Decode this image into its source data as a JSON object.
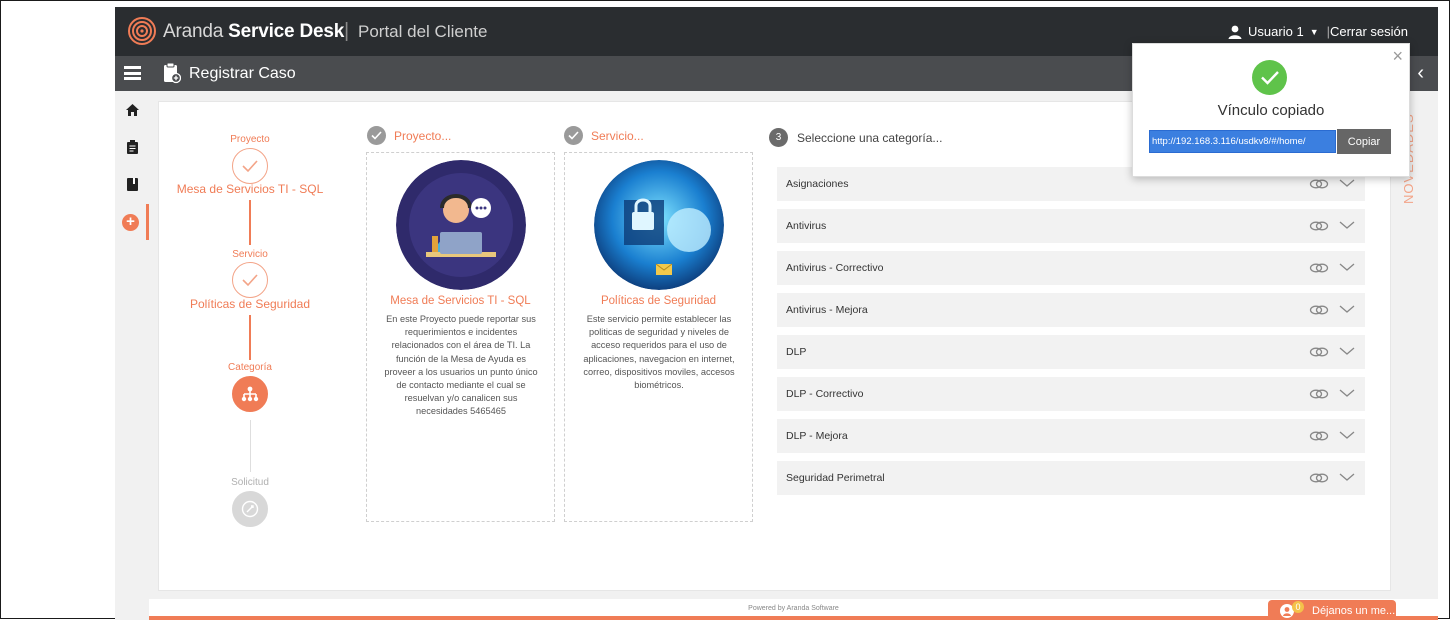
{
  "header": {
    "brand_light": "Aranda",
    "brand_bold": "Service Desk",
    "separator": "|",
    "portal": "Portal del Cliente",
    "user": "Usuario 1",
    "user_separator": "|",
    "logout": "Cerrar sesión"
  },
  "subheader": {
    "title": "Registrar Caso",
    "collapse_icon": "chevron-left"
  },
  "leftnav": {
    "items": [
      "home-icon",
      "clipboard-icon",
      "book-icon",
      "plus-icon"
    ]
  },
  "stepper": {
    "steps": [
      {
        "label": "Proyecto",
        "value": "Mesa de Servicios TI - SQL",
        "state": "done"
      },
      {
        "label": "Servicio",
        "value": "Políticas de Seguridad",
        "state": "done"
      },
      {
        "label": "Categoría",
        "value": "",
        "state": "active"
      },
      {
        "label": "Solicitud",
        "value": "",
        "state": "pending"
      }
    ]
  },
  "cards": {
    "project": {
      "header": "Proyecto...",
      "title": "Mesa de Servicios TI - SQL",
      "description": "En este Proyecto puede reportar sus requerimientos e incidentes relacionados con el área de TI. La función de la Mesa de Ayuda es proveer a los usuarios un punto único de contacto mediante el cual se resuelvan y/o canalicen sus necesidades 5465465"
    },
    "service": {
      "header": "Servicio...",
      "title": "Políticas de Seguridad",
      "description": "Este servicio permite establecer las politicas de seguridad y niveles de acceso requeridos para el uso de aplicaciones, navegacion en internet, correo, dispositivos moviles, accesos biométricos."
    }
  },
  "categories": {
    "step_number": "3",
    "header": "Seleccione una categoría...",
    "items": [
      "Asignaciones",
      "Antivirus",
      "Antivirus - Correctivo",
      "Antivirus - Mejora",
      "DLP",
      "DLP - Correctivo",
      "DLP - Mejora",
      "Seguridad Perimetral"
    ]
  },
  "side_tab": {
    "label": "NOVEDADES"
  },
  "footer": {
    "powered": "Powered by Aranda Software",
    "feedback": "Déjanos un me...",
    "feedback_badge": "0"
  },
  "popup": {
    "message": "Vínculo copiado",
    "url": "http://192.168.3.116/usdkv8/#/home/",
    "copy_label": "Copiar",
    "close": "×"
  },
  "colors": {
    "accent": "#f07c56",
    "topbar": "#2a2d30",
    "subbar": "#4a4c4f",
    "success": "#5fc34a"
  }
}
